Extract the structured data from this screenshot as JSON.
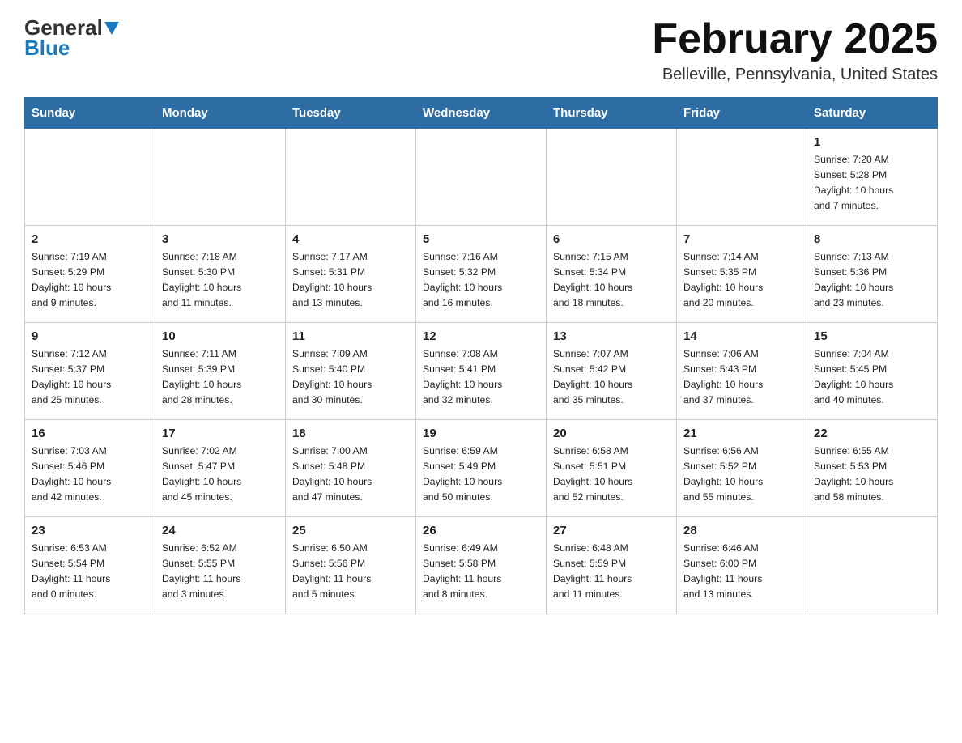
{
  "header": {
    "logo_general": "General",
    "logo_blue": "Blue",
    "month_title": "February 2025",
    "location": "Belleville, Pennsylvania, United States"
  },
  "days_of_week": [
    "Sunday",
    "Monday",
    "Tuesday",
    "Wednesday",
    "Thursday",
    "Friday",
    "Saturday"
  ],
  "weeks": [
    [
      {
        "day": "",
        "info": ""
      },
      {
        "day": "",
        "info": ""
      },
      {
        "day": "",
        "info": ""
      },
      {
        "day": "",
        "info": ""
      },
      {
        "day": "",
        "info": ""
      },
      {
        "day": "",
        "info": ""
      },
      {
        "day": "1",
        "info": "Sunrise: 7:20 AM\nSunset: 5:28 PM\nDaylight: 10 hours\nand 7 minutes."
      }
    ],
    [
      {
        "day": "2",
        "info": "Sunrise: 7:19 AM\nSunset: 5:29 PM\nDaylight: 10 hours\nand 9 minutes."
      },
      {
        "day": "3",
        "info": "Sunrise: 7:18 AM\nSunset: 5:30 PM\nDaylight: 10 hours\nand 11 minutes."
      },
      {
        "day": "4",
        "info": "Sunrise: 7:17 AM\nSunset: 5:31 PM\nDaylight: 10 hours\nand 13 minutes."
      },
      {
        "day": "5",
        "info": "Sunrise: 7:16 AM\nSunset: 5:32 PM\nDaylight: 10 hours\nand 16 minutes."
      },
      {
        "day": "6",
        "info": "Sunrise: 7:15 AM\nSunset: 5:34 PM\nDaylight: 10 hours\nand 18 minutes."
      },
      {
        "day": "7",
        "info": "Sunrise: 7:14 AM\nSunset: 5:35 PM\nDaylight: 10 hours\nand 20 minutes."
      },
      {
        "day": "8",
        "info": "Sunrise: 7:13 AM\nSunset: 5:36 PM\nDaylight: 10 hours\nand 23 minutes."
      }
    ],
    [
      {
        "day": "9",
        "info": "Sunrise: 7:12 AM\nSunset: 5:37 PM\nDaylight: 10 hours\nand 25 minutes."
      },
      {
        "day": "10",
        "info": "Sunrise: 7:11 AM\nSunset: 5:39 PM\nDaylight: 10 hours\nand 28 minutes."
      },
      {
        "day": "11",
        "info": "Sunrise: 7:09 AM\nSunset: 5:40 PM\nDaylight: 10 hours\nand 30 minutes."
      },
      {
        "day": "12",
        "info": "Sunrise: 7:08 AM\nSunset: 5:41 PM\nDaylight: 10 hours\nand 32 minutes."
      },
      {
        "day": "13",
        "info": "Sunrise: 7:07 AM\nSunset: 5:42 PM\nDaylight: 10 hours\nand 35 minutes."
      },
      {
        "day": "14",
        "info": "Sunrise: 7:06 AM\nSunset: 5:43 PM\nDaylight: 10 hours\nand 37 minutes."
      },
      {
        "day": "15",
        "info": "Sunrise: 7:04 AM\nSunset: 5:45 PM\nDaylight: 10 hours\nand 40 minutes."
      }
    ],
    [
      {
        "day": "16",
        "info": "Sunrise: 7:03 AM\nSunset: 5:46 PM\nDaylight: 10 hours\nand 42 minutes."
      },
      {
        "day": "17",
        "info": "Sunrise: 7:02 AM\nSunset: 5:47 PM\nDaylight: 10 hours\nand 45 minutes."
      },
      {
        "day": "18",
        "info": "Sunrise: 7:00 AM\nSunset: 5:48 PM\nDaylight: 10 hours\nand 47 minutes."
      },
      {
        "day": "19",
        "info": "Sunrise: 6:59 AM\nSunset: 5:49 PM\nDaylight: 10 hours\nand 50 minutes."
      },
      {
        "day": "20",
        "info": "Sunrise: 6:58 AM\nSunset: 5:51 PM\nDaylight: 10 hours\nand 52 minutes."
      },
      {
        "day": "21",
        "info": "Sunrise: 6:56 AM\nSunset: 5:52 PM\nDaylight: 10 hours\nand 55 minutes."
      },
      {
        "day": "22",
        "info": "Sunrise: 6:55 AM\nSunset: 5:53 PM\nDaylight: 10 hours\nand 58 minutes."
      }
    ],
    [
      {
        "day": "23",
        "info": "Sunrise: 6:53 AM\nSunset: 5:54 PM\nDaylight: 11 hours\nand 0 minutes."
      },
      {
        "day": "24",
        "info": "Sunrise: 6:52 AM\nSunset: 5:55 PM\nDaylight: 11 hours\nand 3 minutes."
      },
      {
        "day": "25",
        "info": "Sunrise: 6:50 AM\nSunset: 5:56 PM\nDaylight: 11 hours\nand 5 minutes."
      },
      {
        "day": "26",
        "info": "Sunrise: 6:49 AM\nSunset: 5:58 PM\nDaylight: 11 hours\nand 8 minutes."
      },
      {
        "day": "27",
        "info": "Sunrise: 6:48 AM\nSunset: 5:59 PM\nDaylight: 11 hours\nand 11 minutes."
      },
      {
        "day": "28",
        "info": "Sunrise: 6:46 AM\nSunset: 6:00 PM\nDaylight: 11 hours\nand 13 minutes."
      },
      {
        "day": "",
        "info": ""
      }
    ]
  ]
}
